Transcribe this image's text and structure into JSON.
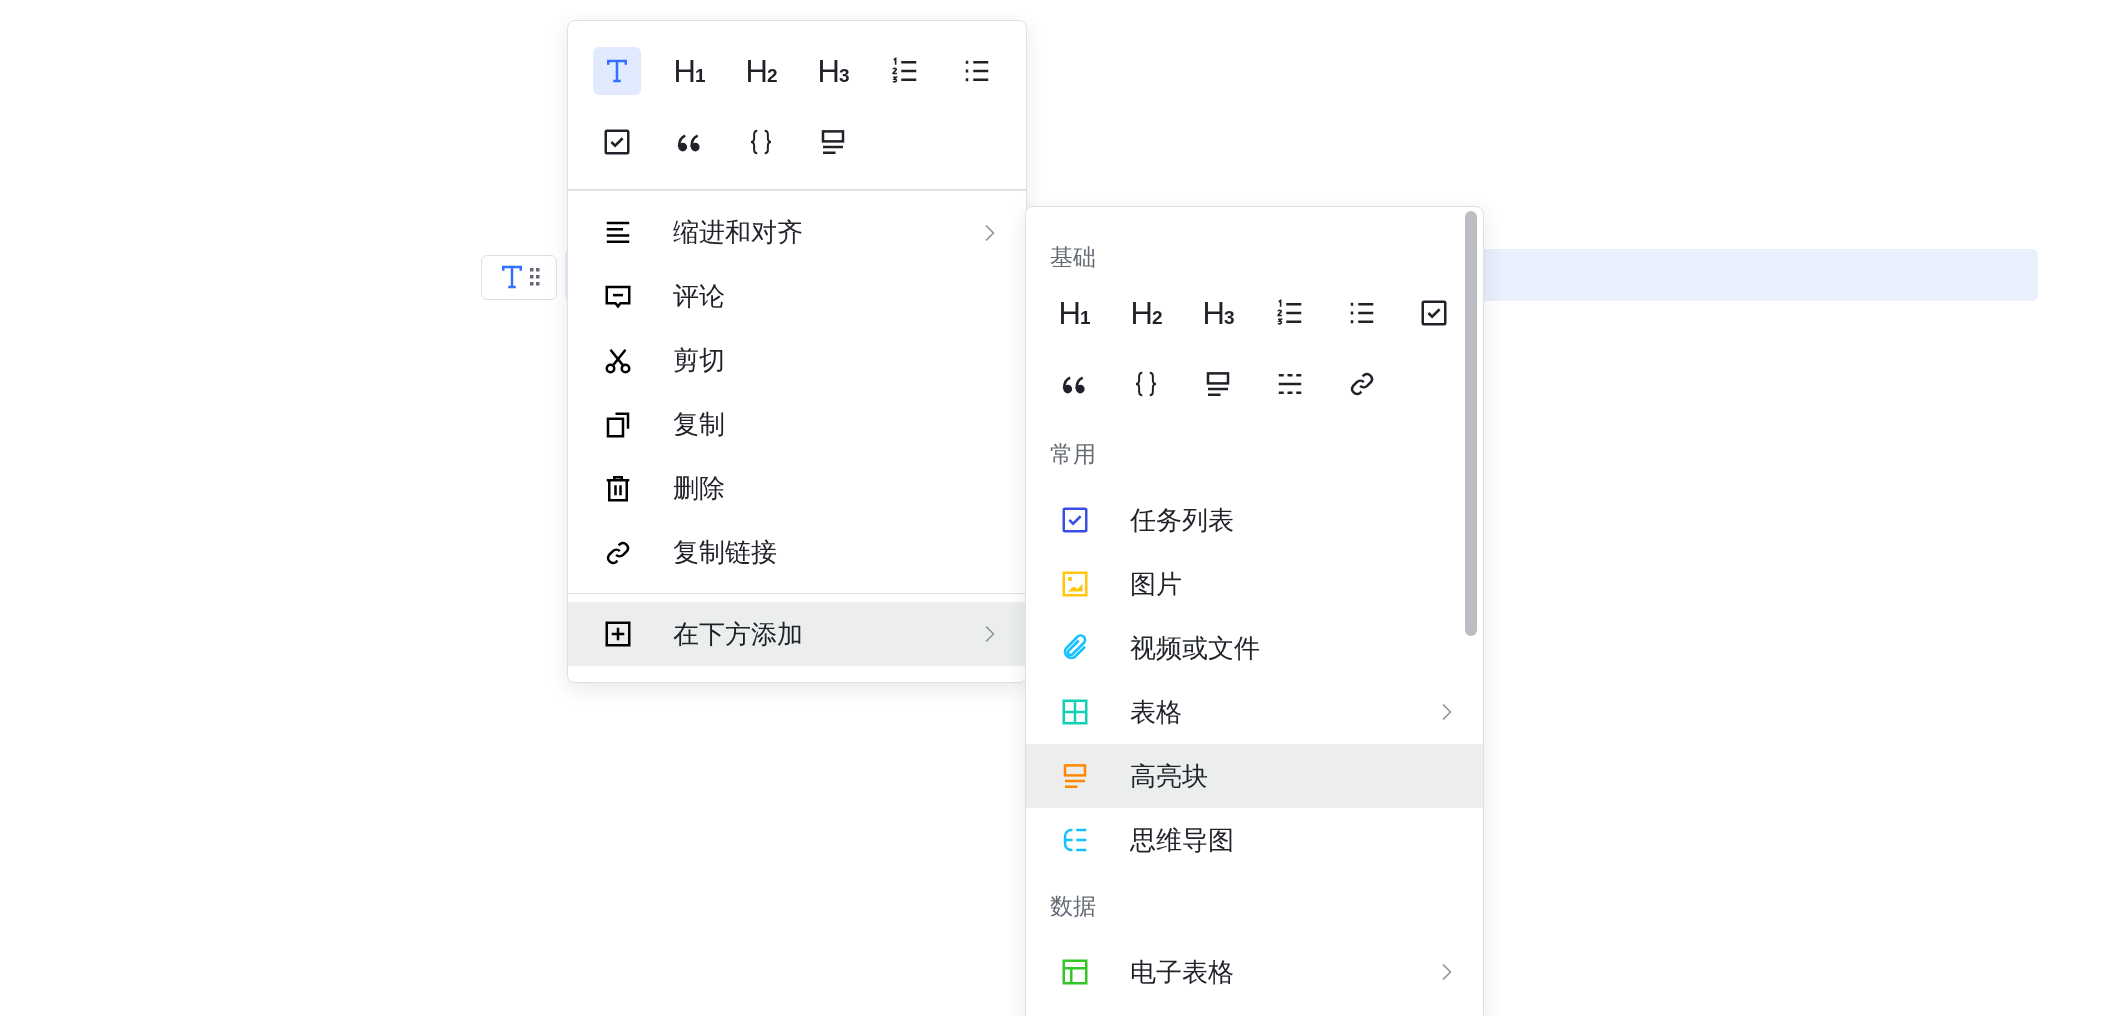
{
  "block_handle": {
    "kind": "text"
  },
  "block_menu": {
    "tools": [
      {
        "kind": "text",
        "selected": true
      },
      {
        "kind": "heading",
        "label": "H$_{1}$",
        "selected": false
      },
      {
        "kind": "heading",
        "label": "H$_{2}$",
        "selected": false
      },
      {
        "kind": "heading",
        "label": "H$_{3}$",
        "selected": false
      },
      {
        "kind": "ordered",
        "selected": false
      },
      {
        "kind": "bullet",
        "selected": false
      },
      {
        "kind": "todo",
        "selected": false
      },
      {
        "kind": "quote",
        "selected": false
      },
      {
        "kind": "code",
        "selected": false
      },
      {
        "kind": "callout",
        "selected": false
      }
    ],
    "items": [
      {
        "kind": "align",
        "label": "缩进和对齐",
        "submenu": true,
        "selected": false
      },
      {
        "kind": "comment",
        "label": "评论",
        "submenu": false,
        "selected": false
      },
      {
        "kind": "cut",
        "label": "剪切",
        "submenu": false,
        "selected": false
      },
      {
        "kind": "copy",
        "label": "复制",
        "submenu": false,
        "selected": false
      },
      {
        "kind": "delete",
        "label": "删除",
        "submenu": false,
        "selected": false
      },
      {
        "kind": "link",
        "label": "复制链接",
        "submenu": false,
        "selected": false
      },
      {
        "kind": "add",
        "label": "在下方添加",
        "submenu": true,
        "selected": true,
        "divider_before": true
      }
    ]
  },
  "insert_menu": {
    "sections": [
      {
        "title": "基础",
        "tools": [
          {
            "kind": "heading",
            "label": "H$_{1}$"
          },
          {
            "kind": "heading",
            "label": "H$_{2}$"
          },
          {
            "kind": "heading",
            "label": "H$_{3}$"
          },
          {
            "kind": "ordered"
          },
          {
            "kind": "bullet"
          },
          {
            "kind": "todo"
          },
          {
            "kind": "quote"
          },
          {
            "kind": "code"
          },
          {
            "kind": "callout"
          },
          {
            "kind": "divider"
          },
          {
            "kind": "link"
          }
        ]
      },
      {
        "title": "常用",
        "items": [
          {
            "kind": "todo",
            "label": "任务列表",
            "color": "#3d4ee6",
            "submenu": false,
            "selected": false
          },
          {
            "kind": "image",
            "label": "图片",
            "color": "#ffc60a",
            "submenu": false,
            "selected": false
          },
          {
            "kind": "attachment",
            "label": "视频或文件",
            "color": "#14c0ff",
            "submenu": false,
            "selected": false
          },
          {
            "kind": "table",
            "label": "表格",
            "color": "#10d1b5",
            "submenu": true,
            "selected": false
          },
          {
            "kind": "callout",
            "label": "高亮块",
            "color": "#ff8800",
            "submenu": false,
            "selected": true
          },
          {
            "kind": "mindmap",
            "label": "思维导图",
            "color": "#14c0ff",
            "submenu": false,
            "selected": false
          }
        ]
      },
      {
        "title": "数据",
        "items": [
          {
            "kind": "sheet",
            "label": "电子表格",
            "color": "#32c724",
            "submenu": true,
            "selected": false
          }
        ]
      }
    ]
  }
}
